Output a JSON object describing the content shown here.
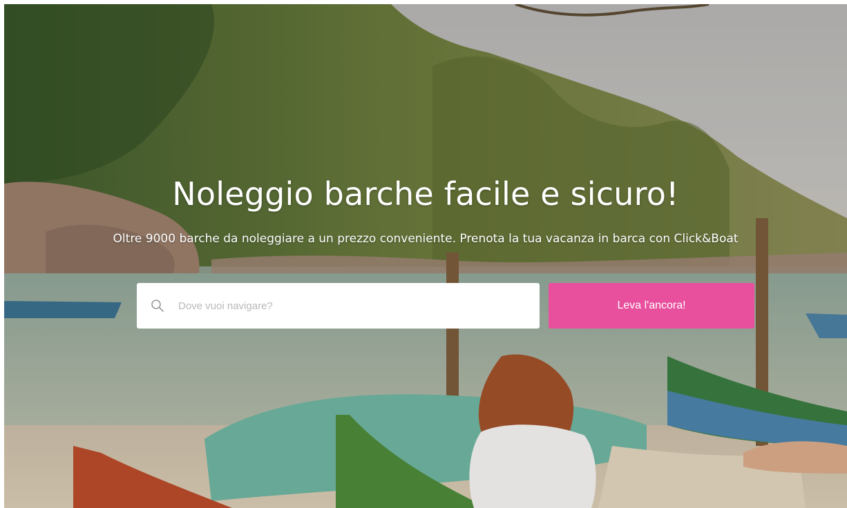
{
  "hero": {
    "title": "Noleggio barche facile e sicuro!",
    "subtitle": "Oltre 9000 barche da noleggiare a un prezzo conveniente. Prenota la tua vacanza in barca con Click&Boat"
  },
  "search": {
    "placeholder": "Dove vuoi navigare?",
    "value": "",
    "icon": "search-icon"
  },
  "cta": {
    "label": "Leva l'ancora!"
  },
  "colors": {
    "accent": "#e8509d",
    "text_on_image": "#ffffff",
    "placeholder": "#b9b9b9"
  }
}
